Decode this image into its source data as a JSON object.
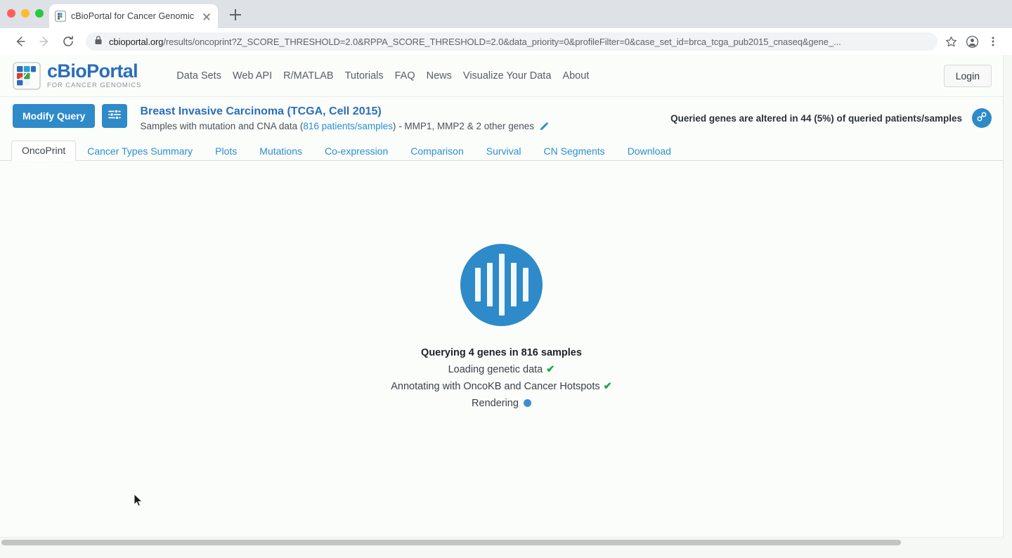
{
  "browser": {
    "tab_title": "cBioPortal for Cancer Genomic",
    "tab_favicon_name": "cbioportal-favicon",
    "new_tab_label": "+",
    "back_label": "Back",
    "forward_label": "Forward",
    "reload_label": "Reload",
    "url_domain": "cbioportal.org",
    "url_path": "/results/oncoprint?Z_SCORE_THRESHOLD=2.0&RPPA_SCORE_THRESHOLD=2.0&data_priority=0&profileFilter=0&case_set_id=brca_tcga_pub2015_cnaseq&gene_...",
    "bookmark_label": "Bookmark this tab",
    "profile_label": "Profile",
    "menu_label": "Customize and control Google Chrome"
  },
  "site": {
    "logo_title": "cBioPortal",
    "logo_subtitle": "FOR CANCER GENOMICS",
    "nav": [
      {
        "label": "Data Sets"
      },
      {
        "label": "Web API"
      },
      {
        "label": "R/MATLAB"
      },
      {
        "label": "Tutorials"
      },
      {
        "label": "FAQ"
      },
      {
        "label": "News"
      },
      {
        "label": "Visualize Your Data"
      },
      {
        "label": "About"
      }
    ],
    "login_label": "Login"
  },
  "query": {
    "modify_query_label": "Modify Query",
    "settings_icon": "sliders-icon",
    "study_title": "Breast Invasive Carcinoma (TCGA, Cell 2015)",
    "study_sub_prefix": "Samples with mutation and CNA data (",
    "study_sub_link": "816 patients/samples",
    "study_sub_suffix": ")",
    "genes_text": "- MMP1, MMP2 & 2 other genes",
    "edit_icon": "pencil-icon",
    "alteration_summary": "Queried genes are altered in 44 (5%) of queried patients/samples",
    "share_icon": "link-icon"
  },
  "tabs": [
    {
      "label": "OncoPrint",
      "active": true
    },
    {
      "label": "Cancer Types Summary",
      "active": false
    },
    {
      "label": "Plots",
      "active": false
    },
    {
      "label": "Mutations",
      "active": false
    },
    {
      "label": "Co-expression",
      "active": false
    },
    {
      "label": "Comparison",
      "active": false
    },
    {
      "label": "Survival",
      "active": false
    },
    {
      "label": "CN Segments",
      "active": false
    },
    {
      "label": "Download",
      "active": false
    }
  ],
  "loader": {
    "icon_name": "cbioportal-waveform-loading-icon",
    "title": "Querying 4 genes in 816 samples",
    "steps": [
      {
        "label": "Loading genetic data",
        "state": "done",
        "glyph": "✔"
      },
      {
        "label": "Annotating with OncoKB and Cancer Hotspots",
        "state": "done",
        "glyph": "✔"
      },
      {
        "label": "Rendering",
        "state": "pending",
        "glyph": "●"
      }
    ]
  },
  "colors": {
    "brand_blue": "#2a6ebb",
    "accent_blue": "#2e8ac9",
    "link_blue": "#2a8fd0",
    "success_green": "#19a84a",
    "page_bg": "#fbfdfb"
  }
}
